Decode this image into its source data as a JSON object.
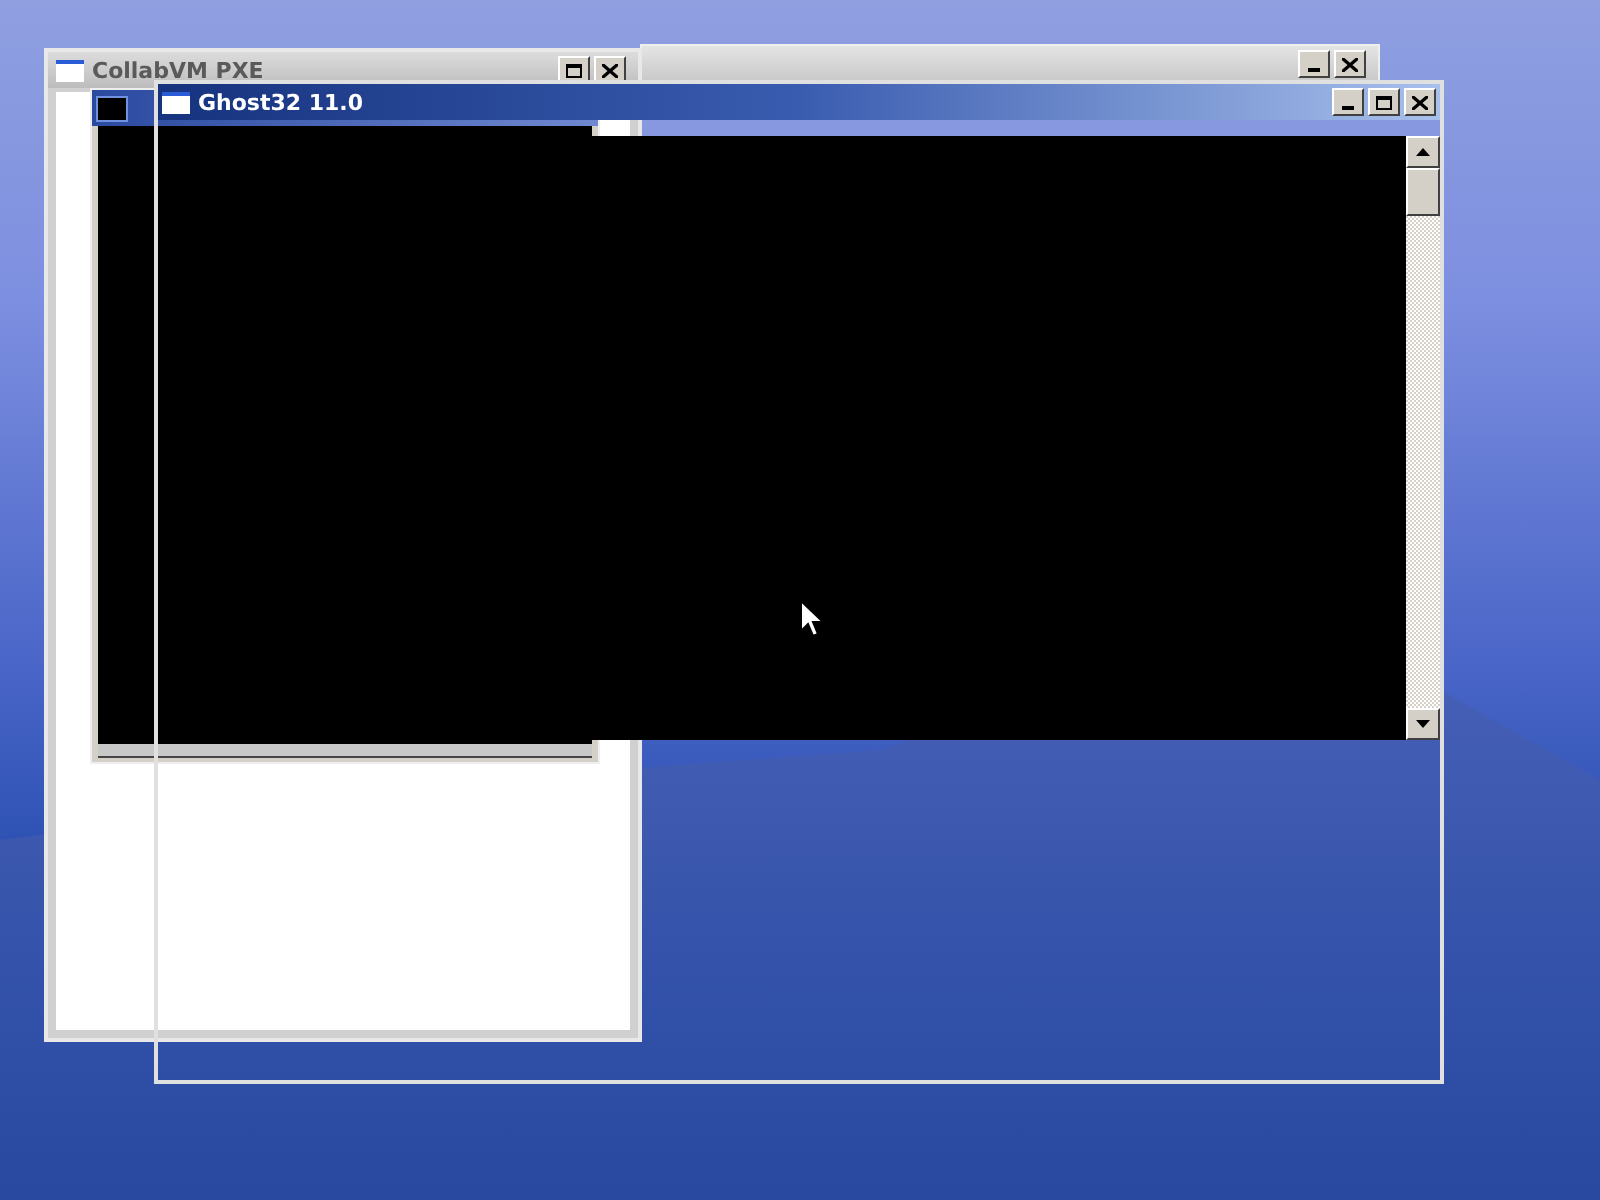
{
  "windows": [
    {
      "kind": "plain",
      "title": "CollabVM PXE"
    },
    {
      "kind": "blank"
    },
    {
      "kind": "console"
    },
    {
      "kind": "ghost",
      "title": "Ghost32 11.0"
    }
  ]
}
